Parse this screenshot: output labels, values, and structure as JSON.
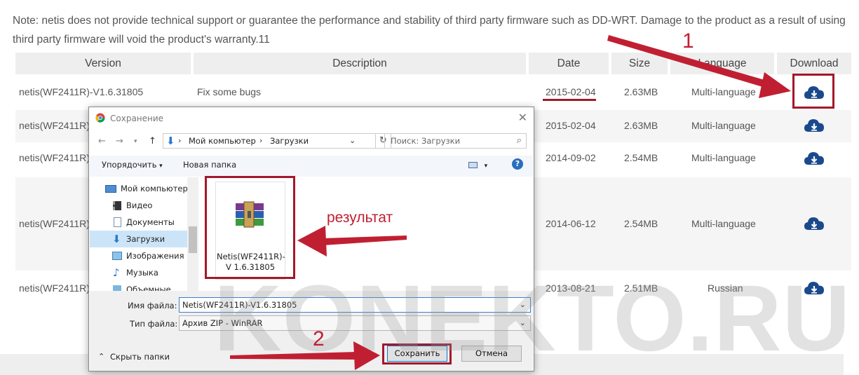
{
  "note": "Note: netis does not provide technical support or guarantee the performance and stability of third party firmware such as DD-WRT. Damage to the product as a result of using third party firmware will void the product's warranty.11",
  "columns": [
    "Version",
    "Description",
    "Date",
    "Size",
    "Language",
    "Download"
  ],
  "rows": [
    {
      "version": "netis(WF2411R)-V1.6.31805",
      "description": "Fix some bugs",
      "date": "2015-02-04",
      "size": "2.63MB",
      "language": "Multi-language"
    },
    {
      "version": "netis(WF2411R)-V",
      "description": "",
      "date": "2015-02-04",
      "size": "2.63MB",
      "language": "Multi-language"
    },
    {
      "version": "netis(WF2411R)-V",
      "description": "",
      "date": "2014-09-02",
      "size": "2.54MB",
      "language": "Multi-language"
    },
    {
      "version": "netis(WF2411R)-V",
      "description": "",
      "date": "2014-06-12",
      "size": "2.54MB",
      "language": "Multi-language"
    },
    {
      "version": "netis(WF2411R)-V",
      "description": "",
      "date": "2013-08-21",
      "size": "2.51MB",
      "language": "Russian"
    }
  ],
  "dialog": {
    "title": "Сохранение",
    "breadcrumb": [
      "Мой компьютер",
      "Загрузки"
    ],
    "search_placeholder": "Поиск: Загрузки",
    "organize": "Упорядочить",
    "new_folder": "Новая папка",
    "tree": [
      "Мой компьютер",
      "Видео",
      "Документы",
      "Загрузки",
      "Изображения",
      "Музыка",
      "Объемные объ"
    ],
    "file_name_display": "Netis(WF2411R)-V 1.6.31805",
    "filename_label": "Имя файла:",
    "filename_value": "Netis(WF2411R)-V1.6.31805",
    "filetype_label": "Тип файла:",
    "filetype_value": "Архив ZIP - WinRAR",
    "hide_folders": "Скрыть папки",
    "save_button": "Сохранить",
    "cancel_button": "Отмена"
  },
  "annotations": {
    "step1": "1",
    "step2": "2",
    "result": "результат"
  },
  "watermark": "KONEKTO.RU",
  "colors": {
    "accent_red": "#a3182a",
    "cloud_blue": "#1a4a8c",
    "header_bg": "#eeeeee"
  }
}
